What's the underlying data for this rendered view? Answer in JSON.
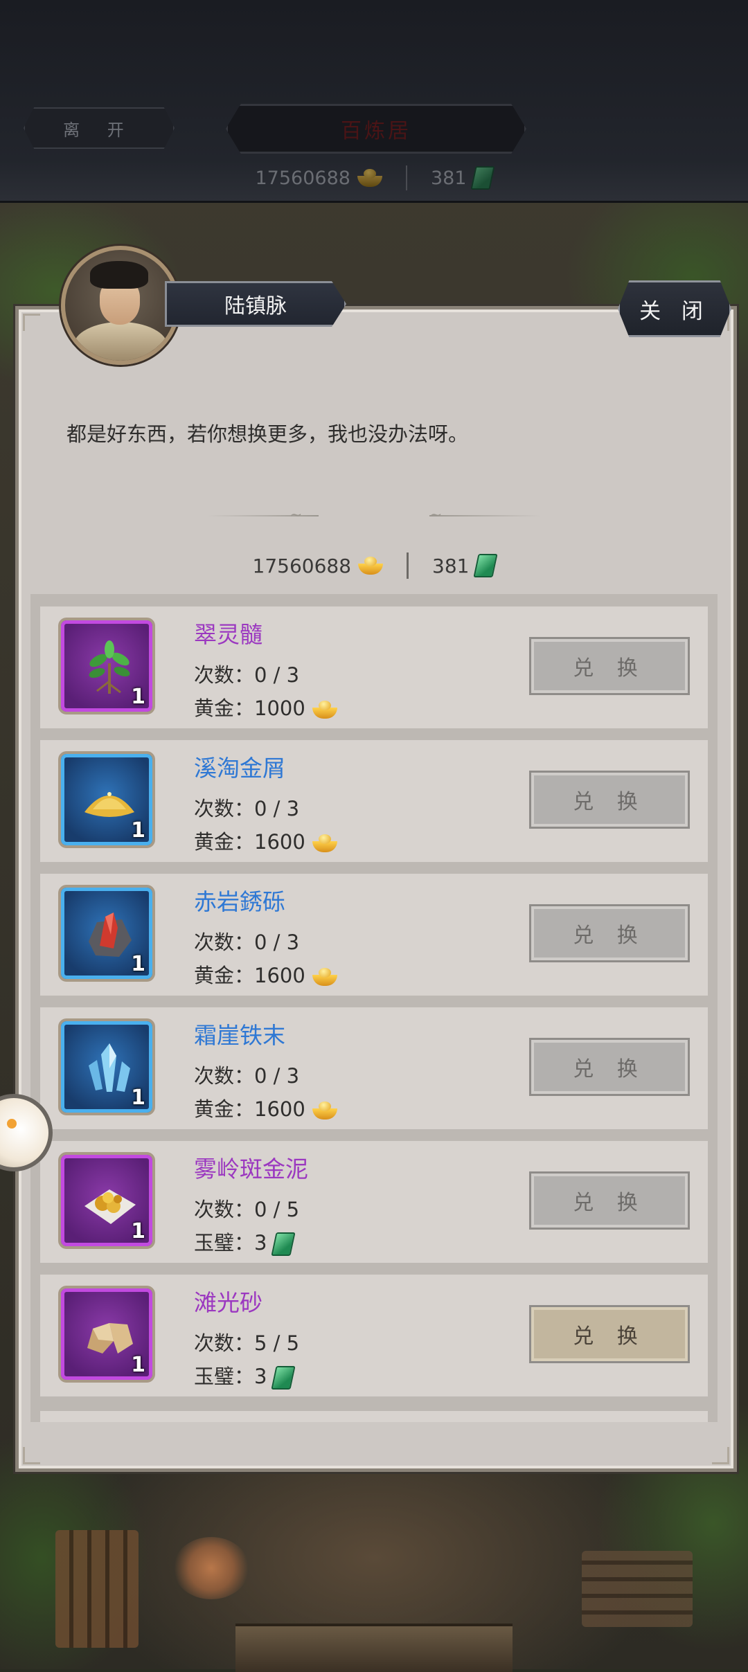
{
  "header": {
    "leave_label": "离 开",
    "place_title": "百炼居",
    "gold": "17560688",
    "jade": "381"
  },
  "dialog": {
    "npc_name": "陆镇脉",
    "close_label": "关 闭",
    "text": "都是好东西，若你想换更多，我也没办法呀。",
    "gold": "17560688",
    "jade": "381"
  },
  "items": [
    {
      "name": "翠灵髓",
      "rarity": "purple",
      "count": "1",
      "times": "次数：0 / 3",
      "price": "黄金：1000",
      "currency_icon": "gold-ingot-icon",
      "button": "兑 换",
      "icon": "herb-icon"
    },
    {
      "name": "溪淘金屑",
      "rarity": "blue",
      "count": "1",
      "times": "次数：0 / 3",
      "price": "黄金：1600",
      "currency_icon": "gold-ingot-icon",
      "button": "兑 换",
      "icon": "gold-dust-icon"
    },
    {
      "name": "赤岩銹砾",
      "rarity": "blue",
      "count": "1",
      "times": "次数：0 / 3",
      "price": "黄金：1600",
      "currency_icon": "gold-ingot-icon",
      "button": "兑 换",
      "icon": "red-crystal-rock-icon"
    },
    {
      "name": "霜崖铁末",
      "rarity": "blue",
      "count": "1",
      "times": "次数：0 / 3",
      "price": "黄金：1600",
      "currency_icon": "gold-ingot-icon",
      "button": "兑 换",
      "icon": "ice-crystal-icon"
    },
    {
      "name": "雾岭斑金泥",
      "rarity": "purple",
      "count": "1",
      "times": "次数：0 / 5",
      "price": "玉璧：3",
      "currency_icon": "jade-icon",
      "button": "兑 换",
      "icon": "gold-nugget-icon"
    },
    {
      "name": "滩光砂",
      "rarity": "purple",
      "count": "1",
      "times": "次数：5 / 5",
      "price": "玉璧：3",
      "currency_icon": "jade-icon",
      "button": "兑 换",
      "icon": "sand-stone-icon"
    }
  ],
  "colors": {
    "purple_text": "#9b38c0",
    "blue_text": "#2f78d4",
    "panel_bg": "#cdc8c4"
  }
}
